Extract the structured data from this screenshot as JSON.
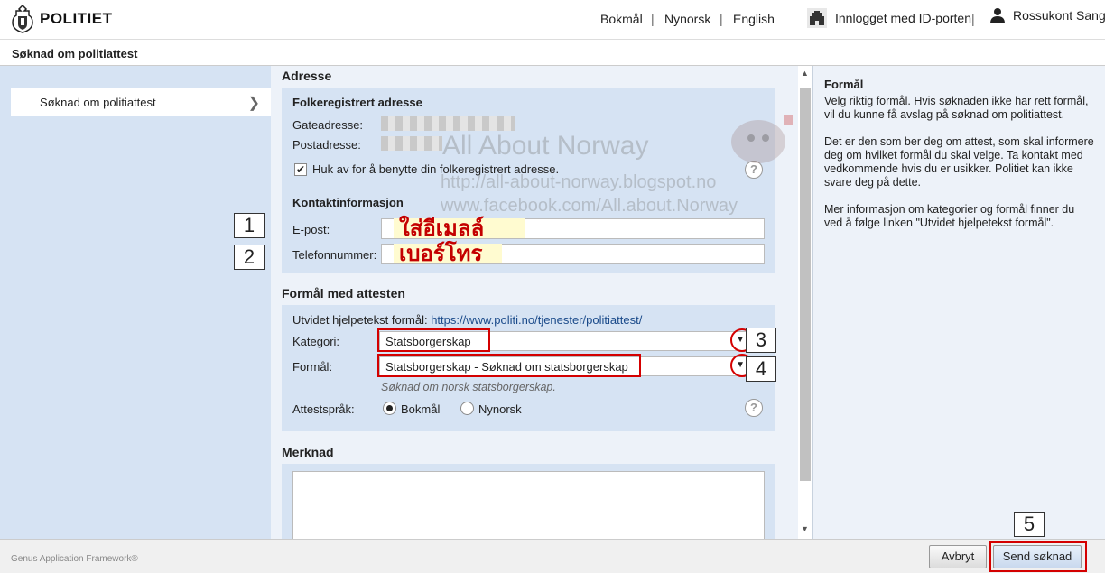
{
  "header": {
    "brand": "POLITIET",
    "languages": [
      "Bokmål",
      "Nynorsk",
      "English"
    ],
    "separator": "|",
    "login_text": "Innlogget med ID-porten",
    "user_name": "Rossukont Sangp"
  },
  "page_title": "Søknad om politiattest",
  "sidebar": {
    "items": [
      {
        "label": "Søknad om politiattest"
      }
    ]
  },
  "annotations": {
    "step1": "1",
    "step2": "2",
    "step3": "3",
    "step4": "4",
    "step5": "5",
    "thai_email": "ใส่อีเมลล์",
    "thai_phone": "เบอร์โทร"
  },
  "watermark": {
    "line1": "All About Norway",
    "line2": "http://all-about-norway.blogspot.no",
    "line3": "www.facebook.com/All.about.Norway"
  },
  "address": {
    "section_title": "Adresse",
    "subtitle": "Folkeregistrert adresse",
    "street_label": "Gateadresse:",
    "postal_label": "Postadresse:",
    "checkbox_label": "Huk av for å benytte din folkeregistrert adresse.",
    "checkbox_checked": true
  },
  "contact": {
    "subtitle": "Kontaktinformasjon",
    "email_label": "E-post:",
    "phone_label": "Telefonnummer:"
  },
  "purpose": {
    "section_title": "Formål med attesten",
    "help_text_label": "Utvidet hjelpetekst formål:",
    "help_link": "https://www.politi.no/tjenester/politiattest/",
    "category_label": "Kategori:",
    "category_value": "Statsborgerskap",
    "purpose_label": "Formål:",
    "purpose_value": "Statsborgerskap - Søknad om statsborgerskap",
    "purpose_hint": "Søknad om norsk statsborgerskap.",
    "language_label": "Attestspråk:",
    "language_options": [
      "Bokmål",
      "Nynorsk"
    ],
    "language_selected": "Bokmål"
  },
  "remarks": {
    "section_title": "Merknad"
  },
  "help_pane": {
    "title": "Formål",
    "paragraphs": [
      "Velg riktig formål. Hvis søknaden ikke har rett formål, vil du kunne få avslag på søknad om politiattest.",
      "Det er den som ber deg om attest, som skal informere deg om hvilket formål du skal velge. Ta kontakt med vedkommende hvis du er usikker. Politiet kan ikke svare deg på dette.",
      "Mer informasjon om kategorier og formål finner du ved å følge linken \"Utvidet hjelpetekst formål\"."
    ]
  },
  "footer": {
    "framework": "Genus Application Framework®",
    "cancel_label": "Avbryt",
    "submit_label": "Send søknad"
  },
  "colors": {
    "panel": "#d6e3f3",
    "background": "#edf2f9",
    "annotation_red": "#d40000",
    "link": "#1a4a8a"
  }
}
